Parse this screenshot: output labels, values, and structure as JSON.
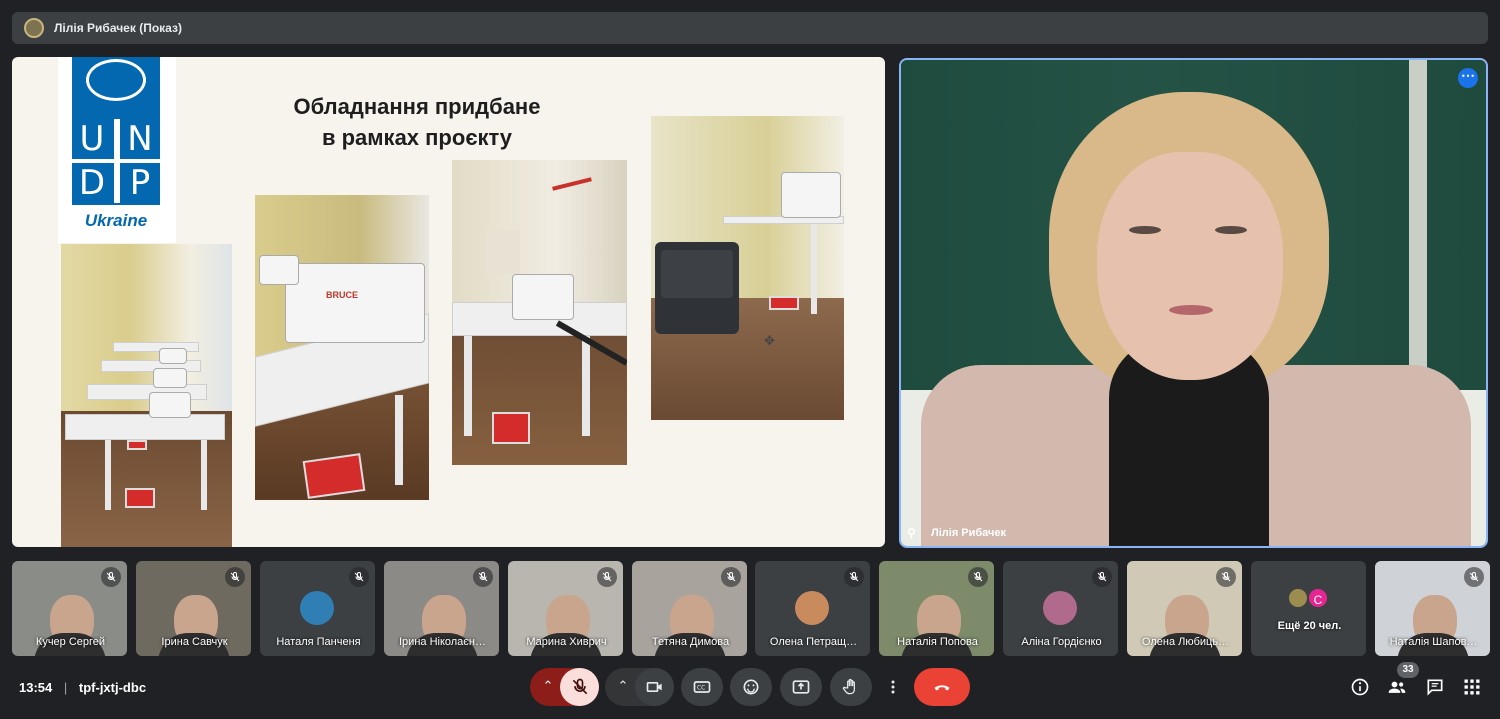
{
  "presenter_bar": {
    "title": "Лілія Рибачек (Показ)"
  },
  "slide": {
    "title_line1": "Обладнання придбане",
    "title_line2": "в рамках проєкту",
    "logo_letters": [
      "U",
      "N",
      "D",
      "P"
    ],
    "logo_caption": "Ukraine",
    "photos": [
      {
        "label": "sewing-room-photo"
      },
      {
        "label": "bruce-machine-photo",
        "machine_text": "BRUCE"
      },
      {
        "label": "overlock-machine-photo"
      },
      {
        "label": "power-station-photo"
      }
    ]
  },
  "main_video": {
    "name": "Лілія Рибачек"
  },
  "participants": [
    {
      "name": "Кучер Сергей",
      "kind": "video",
      "bg": "#8a8d87"
    },
    {
      "name": "Ірина Савчук",
      "kind": "video",
      "bg": "#6f6a60"
    },
    {
      "name": "Наталя Панченя",
      "kind": "avatar",
      "bg": "#3c4043",
      "avatar": "#2f7fb5"
    },
    {
      "name": "Ірина Ніколаєн…",
      "kind": "video",
      "bg": "#8c8a86"
    },
    {
      "name": "Марина Хиврич",
      "kind": "video",
      "bg": "#b9b6b0"
    },
    {
      "name": "Тетяна Димова",
      "kind": "video",
      "bg": "#a8a39d"
    },
    {
      "name": "Олена Петращ…",
      "kind": "avatar",
      "bg": "#3c4043",
      "avatar": "#c98a5e"
    },
    {
      "name": "Наталія Попова",
      "kind": "video",
      "bg": "#7d8b6b"
    },
    {
      "name": "Аліна Гордієнко",
      "kind": "avatar",
      "bg": "#3c4043",
      "avatar": "#b06a8c"
    },
    {
      "name": "Олена Любиць…",
      "kind": "video",
      "bg": "#d0c9b6"
    },
    {
      "name": "Ещё 20 чел.",
      "kind": "more",
      "bg": "#3c4043"
    },
    {
      "name": "Наталія Шапов…",
      "kind": "video",
      "bg": "#cfd2d6"
    }
  ],
  "more_avatar_letter": "С",
  "bottom_bar": {
    "time": "13:54",
    "separator": "|",
    "meeting_code": "tpf-jxtj-dbc",
    "people_count": "33"
  },
  "colors": {
    "background": "#202124",
    "tile": "#3c4043",
    "active_border": "#8ab4f8",
    "end_call": "#ea4335",
    "mic_off": "#f9dedc",
    "mic_off_group": "#8c1d18",
    "accent_blue": "#1a73e8",
    "undp_blue": "#0468b1"
  },
  "icons": {
    "mic": "mic-off-icon",
    "camera": "videocam-icon",
    "captions": "closed-captions-icon",
    "emoji": "emoji-icon",
    "present": "present-screen-icon",
    "hand": "raise-hand-icon",
    "more": "more-vert-icon",
    "end": "call-end-icon",
    "info": "info-icon",
    "people": "people-icon",
    "chat": "chat-icon",
    "activities": "apps-grid-icon"
  }
}
